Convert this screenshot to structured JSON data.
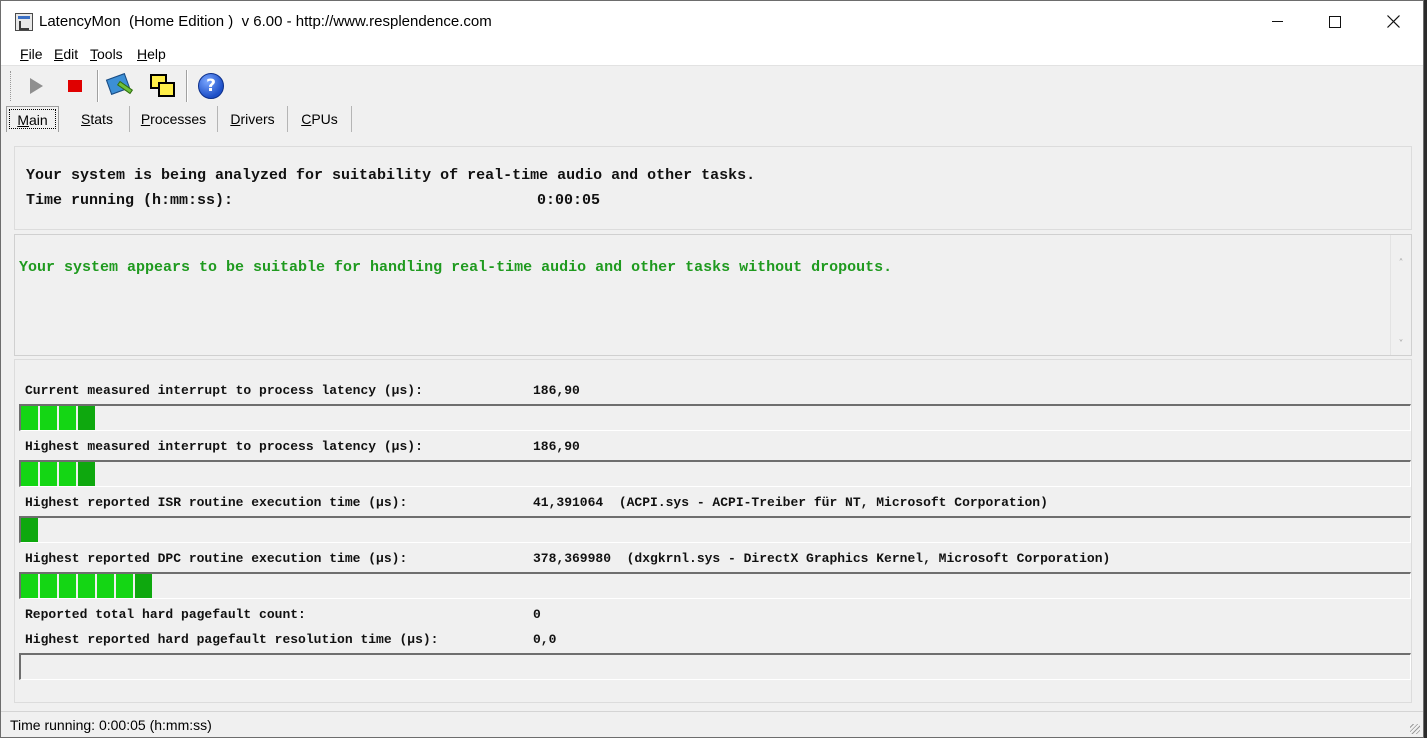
{
  "window": {
    "title": "LatencyMon  (Home Edition )  v 6.00 - http://www.resplendence.com"
  },
  "menu": [
    {
      "key": "F",
      "rest": "ile"
    },
    {
      "key": "E",
      "rest": "dit"
    },
    {
      "key": "T",
      "rest": "ools"
    },
    {
      "key": "H",
      "rest": "elp"
    }
  ],
  "toolbar": {
    "icons": [
      "play-icon",
      "stop-icon",
      "tools-icon",
      "windows-icon",
      "help-icon"
    ],
    "help_glyph": "?"
  },
  "tabs": [
    {
      "key": "M",
      "rest": "ain",
      "active": true
    },
    {
      "key": "S",
      "rest": "tats",
      "active": false
    },
    {
      "key": "P",
      "rest": "rocesses",
      "active": false
    },
    {
      "key": "D",
      "rest": "rivers",
      "active": false
    },
    {
      "key": "C",
      "rest": "PUs",
      "active": false
    }
  ],
  "analysis": {
    "line1": "Your system is being analyzed for suitability of real-time audio and other tasks.",
    "time_label": "Time running (h:mm:ss):",
    "time_value": "0:00:05"
  },
  "verdict": {
    "text": "Your system appears to be suitable for handling real-time audio and other tasks without dropouts.",
    "color": "#1f9a1f"
  },
  "metrics": [
    {
      "label": "Current measured interrupt to process latency (µs):",
      "value": "186,90",
      "segments": 4
    },
    {
      "label": "Highest measured interrupt to process latency (µs):",
      "value": "186,90",
      "segments": 4
    },
    {
      "label": "Highest reported ISR routine execution time (µs):",
      "value": "41,391064  (ACPI.sys - ACPI-Treiber für NT, Microsoft Corporation)",
      "segments": 1
    },
    {
      "label": "Highest reported DPC routine execution time (µs):",
      "value": "378,369980  (dxgkrnl.sys - DirectX Graphics Kernel, Microsoft Corporation)",
      "segments": 7
    },
    {
      "label": "Reported total hard pagefault count:",
      "value": "0",
      "segments": null
    },
    {
      "label": "Highest reported hard pagefault resolution time (µs):",
      "value": "0,0",
      "segments": 0
    }
  ],
  "status": {
    "text": "Time running: 0:00:05  (h:mm:ss)"
  },
  "colors": {
    "bar_green": "#14d614",
    "bar_green_dark": "#0ea80e",
    "stop_red": "#e00000"
  }
}
